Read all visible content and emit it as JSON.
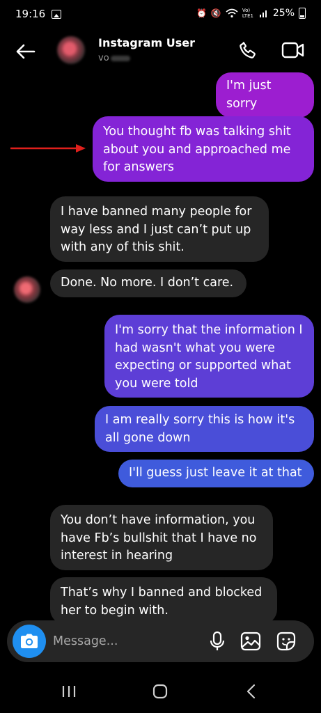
{
  "status_bar": {
    "time": "19:16",
    "network": "Vo) LTE1",
    "battery": "25%"
  },
  "header": {
    "contact_name": "Instagram User",
    "contact_sub": "vo"
  },
  "messages": [
    {
      "direction": "sent",
      "text": "I'm just sorry"
    },
    {
      "direction": "sent",
      "text": "You thought fb was talking shit about you and approached me for answers"
    },
    {
      "direction": "received",
      "text": "I have banned many people for way less and I just can’t put up with any of this shit."
    },
    {
      "direction": "received",
      "text": "Done. No more. I don’t care."
    },
    {
      "direction": "sent",
      "text": "I'm sorry that the information I had wasn't what you were expecting or supported what you were told"
    },
    {
      "direction": "sent",
      "text": "I am really sorry this is how it's all gone down"
    },
    {
      "direction": "sent",
      "text": "I'll guess just leave it at that"
    },
    {
      "direction": "received",
      "text": "You don’t have information, you have Fb’s bullshit that I have no interest in hearing"
    },
    {
      "direction": "received",
      "text": "That’s why I banned and blocked her to begin with."
    }
  ],
  "composer": {
    "placeholder": "Message..."
  },
  "icons": {
    "back": "arrow-left-icon",
    "call": "phone-icon",
    "video": "video-camera-icon",
    "camera": "camera-icon",
    "mic": "microphone-icon",
    "gallery": "image-icon",
    "sticker": "sticker-icon"
  },
  "colors": {
    "background": "#000000",
    "received_bubble": "#262626",
    "sent_bubble_top": "#9c1ed0",
    "sent_bubble_bottom": "#3f5bdc",
    "annotation_arrow": "#e0201c",
    "camera_button": "#1f8ff0"
  }
}
